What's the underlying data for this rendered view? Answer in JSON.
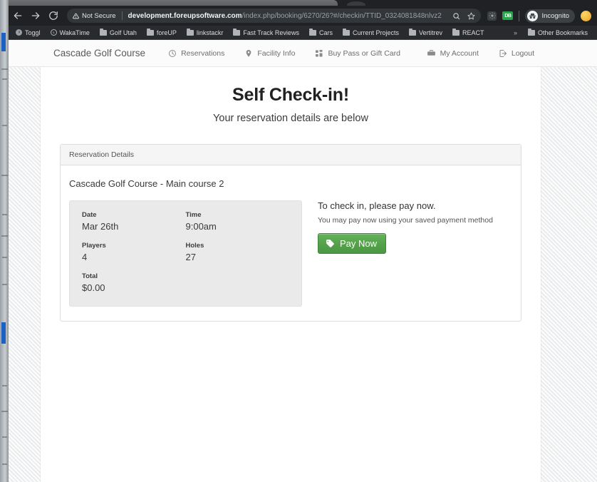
{
  "browser": {
    "nav": {
      "back_icon": "arrow-left-icon",
      "forward_icon": "arrow-right-icon",
      "reload_icon": "reload-icon"
    },
    "omnibox": {
      "security_label": "Not Secure",
      "security_icon": "warning-triangle-icon",
      "url_host": "development.foreupsoftware.com",
      "url_path": "/index.php/booking/6270/26?#/checkin/TTID_0324081848nlvz2",
      "zoom_icon": "search-zoom-icon",
      "bookmark_icon": "star-icon"
    },
    "toolbar_right": {
      "extension_dark_icon": "puzzle-extension-icon",
      "extension_green_label": "DB",
      "incognito_label": "Incognito",
      "incognito_icon": "incognito-hat-icon",
      "profile_icon": "profile-avatar-icon"
    },
    "bookmarks": [
      {
        "label": "Toggl",
        "icon": "toggl-circle-icon"
      },
      {
        "label": "WakaTime",
        "icon": "wakatime-circle-icon"
      },
      {
        "label": "Golf Utah",
        "icon": "folder-icon"
      },
      {
        "label": "foreUP",
        "icon": "folder-icon"
      },
      {
        "label": "linkstackr",
        "icon": "folder-icon"
      },
      {
        "label": "Fast Track Reviews",
        "icon": "folder-icon"
      },
      {
        "label": "Cars",
        "icon": "folder-icon"
      },
      {
        "label": "Current Projects",
        "icon": "folder-icon"
      },
      {
        "label": "Vertitrev",
        "icon": "folder-icon"
      },
      {
        "label": "REACT",
        "icon": "folder-icon"
      }
    ],
    "bookmarks_overflow": "»",
    "other_bookmarks": {
      "label": "Other Bookmarks",
      "icon": "folder-icon"
    }
  },
  "site": {
    "brand": "Cascade Golf Course",
    "nav_links": [
      {
        "label": "Reservations",
        "icon": "clock-icon"
      },
      {
        "label": "Facility Info",
        "icon": "map-pin-icon"
      },
      {
        "label": "Buy Pass or Gift Card",
        "icon": "grid-squares-icon"
      }
    ],
    "nav_right": [
      {
        "label": "My Account",
        "icon": "briefcase-icon"
      },
      {
        "label": "Logout",
        "icon": "logout-arrow-icon"
      }
    ]
  },
  "page": {
    "title": "Self Check-in!",
    "subtitle": "Your reservation details are below",
    "panel": {
      "heading": "Reservation Details",
      "course_name": "Cascade Golf Course - Main course 2",
      "details": [
        {
          "label": "Date",
          "value": "Mar 26th"
        },
        {
          "label": "Time",
          "value": "9:00am"
        },
        {
          "label": "Players",
          "value": "4"
        },
        {
          "label": "Holes",
          "value": "27"
        },
        {
          "label": "Total",
          "value": "$0.00"
        }
      ],
      "payment": {
        "title": "To check in, please pay now.",
        "subtitle": "You may pay now using your saved payment method",
        "button_label": "Pay Now",
        "button_icon": "price-tag-icon",
        "button_color": "#54a14a"
      }
    }
  }
}
